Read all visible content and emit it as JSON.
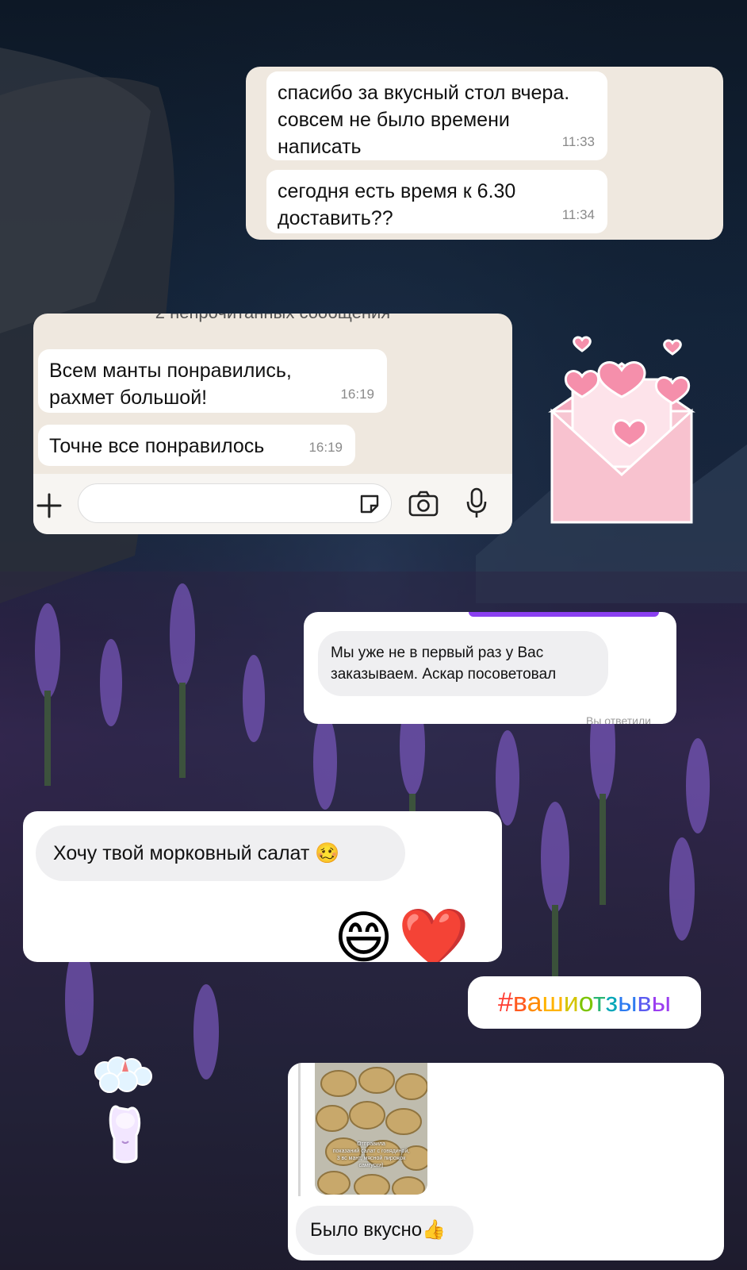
{
  "wa_chat_1": {
    "messages": [
      {
        "text": "спасибо за вкусный стол вчера.\nсовсем не было времени\nнаписать",
        "time": "11:33"
      },
      {
        "text": "сегодня есть время к 6.30\nдоставить??",
        "time": "11:34"
      }
    ]
  },
  "wa_chat_2": {
    "unread_divider": "2 непрочитанных сообщения",
    "messages": [
      {
        "text": "Всем манты понравились,\nрахмет большой!",
        "time": "16:19"
      },
      {
        "text": "Точне все понравилось",
        "time": "16:19"
      }
    ],
    "input": {
      "placeholder": ""
    }
  },
  "ig_chat_1": {
    "message": "Мы уже не в первый раз у Вас\nзаказываем. Аскар посоветовал",
    "status": "Вы ответили"
  },
  "ig_chat_2": {
    "message": "Хочу твой морковный салат 🥴",
    "reactions": "😄❤️"
  },
  "hashtag": {
    "chars": [
      {
        "c": "#",
        "color": "#ff3b30"
      },
      {
        "c": "в",
        "color": "#ff5a1f"
      },
      {
        "c": "а",
        "color": "#ff8a00"
      },
      {
        "c": "ш",
        "color": "#ffb300"
      },
      {
        "c": "и",
        "color": "#d4c400"
      },
      {
        "c": "о",
        "color": "#7cc400"
      },
      {
        "c": "т",
        "color": "#2bb673"
      },
      {
        "c": "з",
        "color": "#00a6b8"
      },
      {
        "c": "ы",
        "color": "#2d7bf0"
      },
      {
        "c": "в",
        "color": "#5b5bf0"
      },
      {
        "c": "ы",
        "color": "#9b3df0"
      }
    ]
  },
  "ig_chat_3": {
    "photo_caption": "Отправила\nпоказаний салат с говядиной,\n3 вс мант, мясной пирожок\nсамгуски)",
    "message": "Было вкусно👍"
  },
  "stickers": {
    "envelope": "envelope-with-hearts-sticker",
    "bunny": "bunny-with-cloud-sticker"
  },
  "colors": {
    "wa_bg": "#efe8df",
    "ig_accent": "#8a3ff0"
  }
}
